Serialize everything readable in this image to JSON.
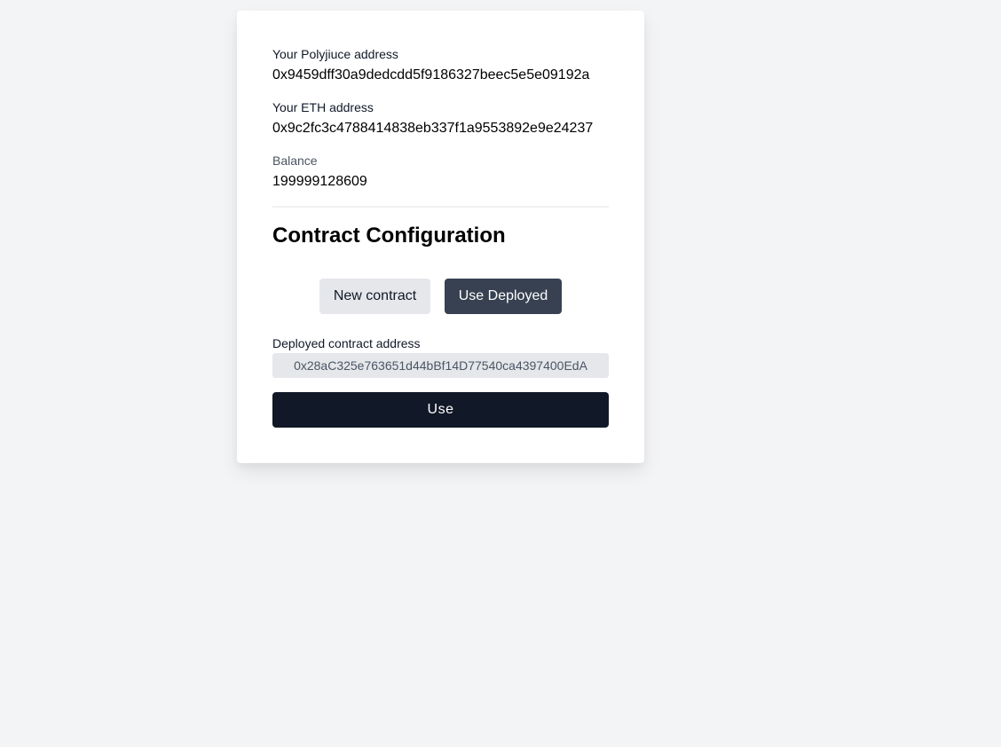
{
  "account": {
    "polyjuice_label": "Your Polyjiuce address",
    "polyjuice_value": "0x9459dff30a9dedcdd5f9186327beec5e5e09192a",
    "eth_label": "Your ETH address",
    "eth_value": "0x9c2fc3c4788414838eb337f1a9553892e9e24237",
    "balance_label": "Balance",
    "balance_value": "199999128609"
  },
  "contract": {
    "title": "Contract Configuration",
    "new_button": "New contract",
    "use_deployed_button": "Use Deployed",
    "address_label": "Deployed contract address",
    "address_value": "0x28aC325e763651d44bBf14D77540ca4397400EdA",
    "use_button": "Use"
  }
}
